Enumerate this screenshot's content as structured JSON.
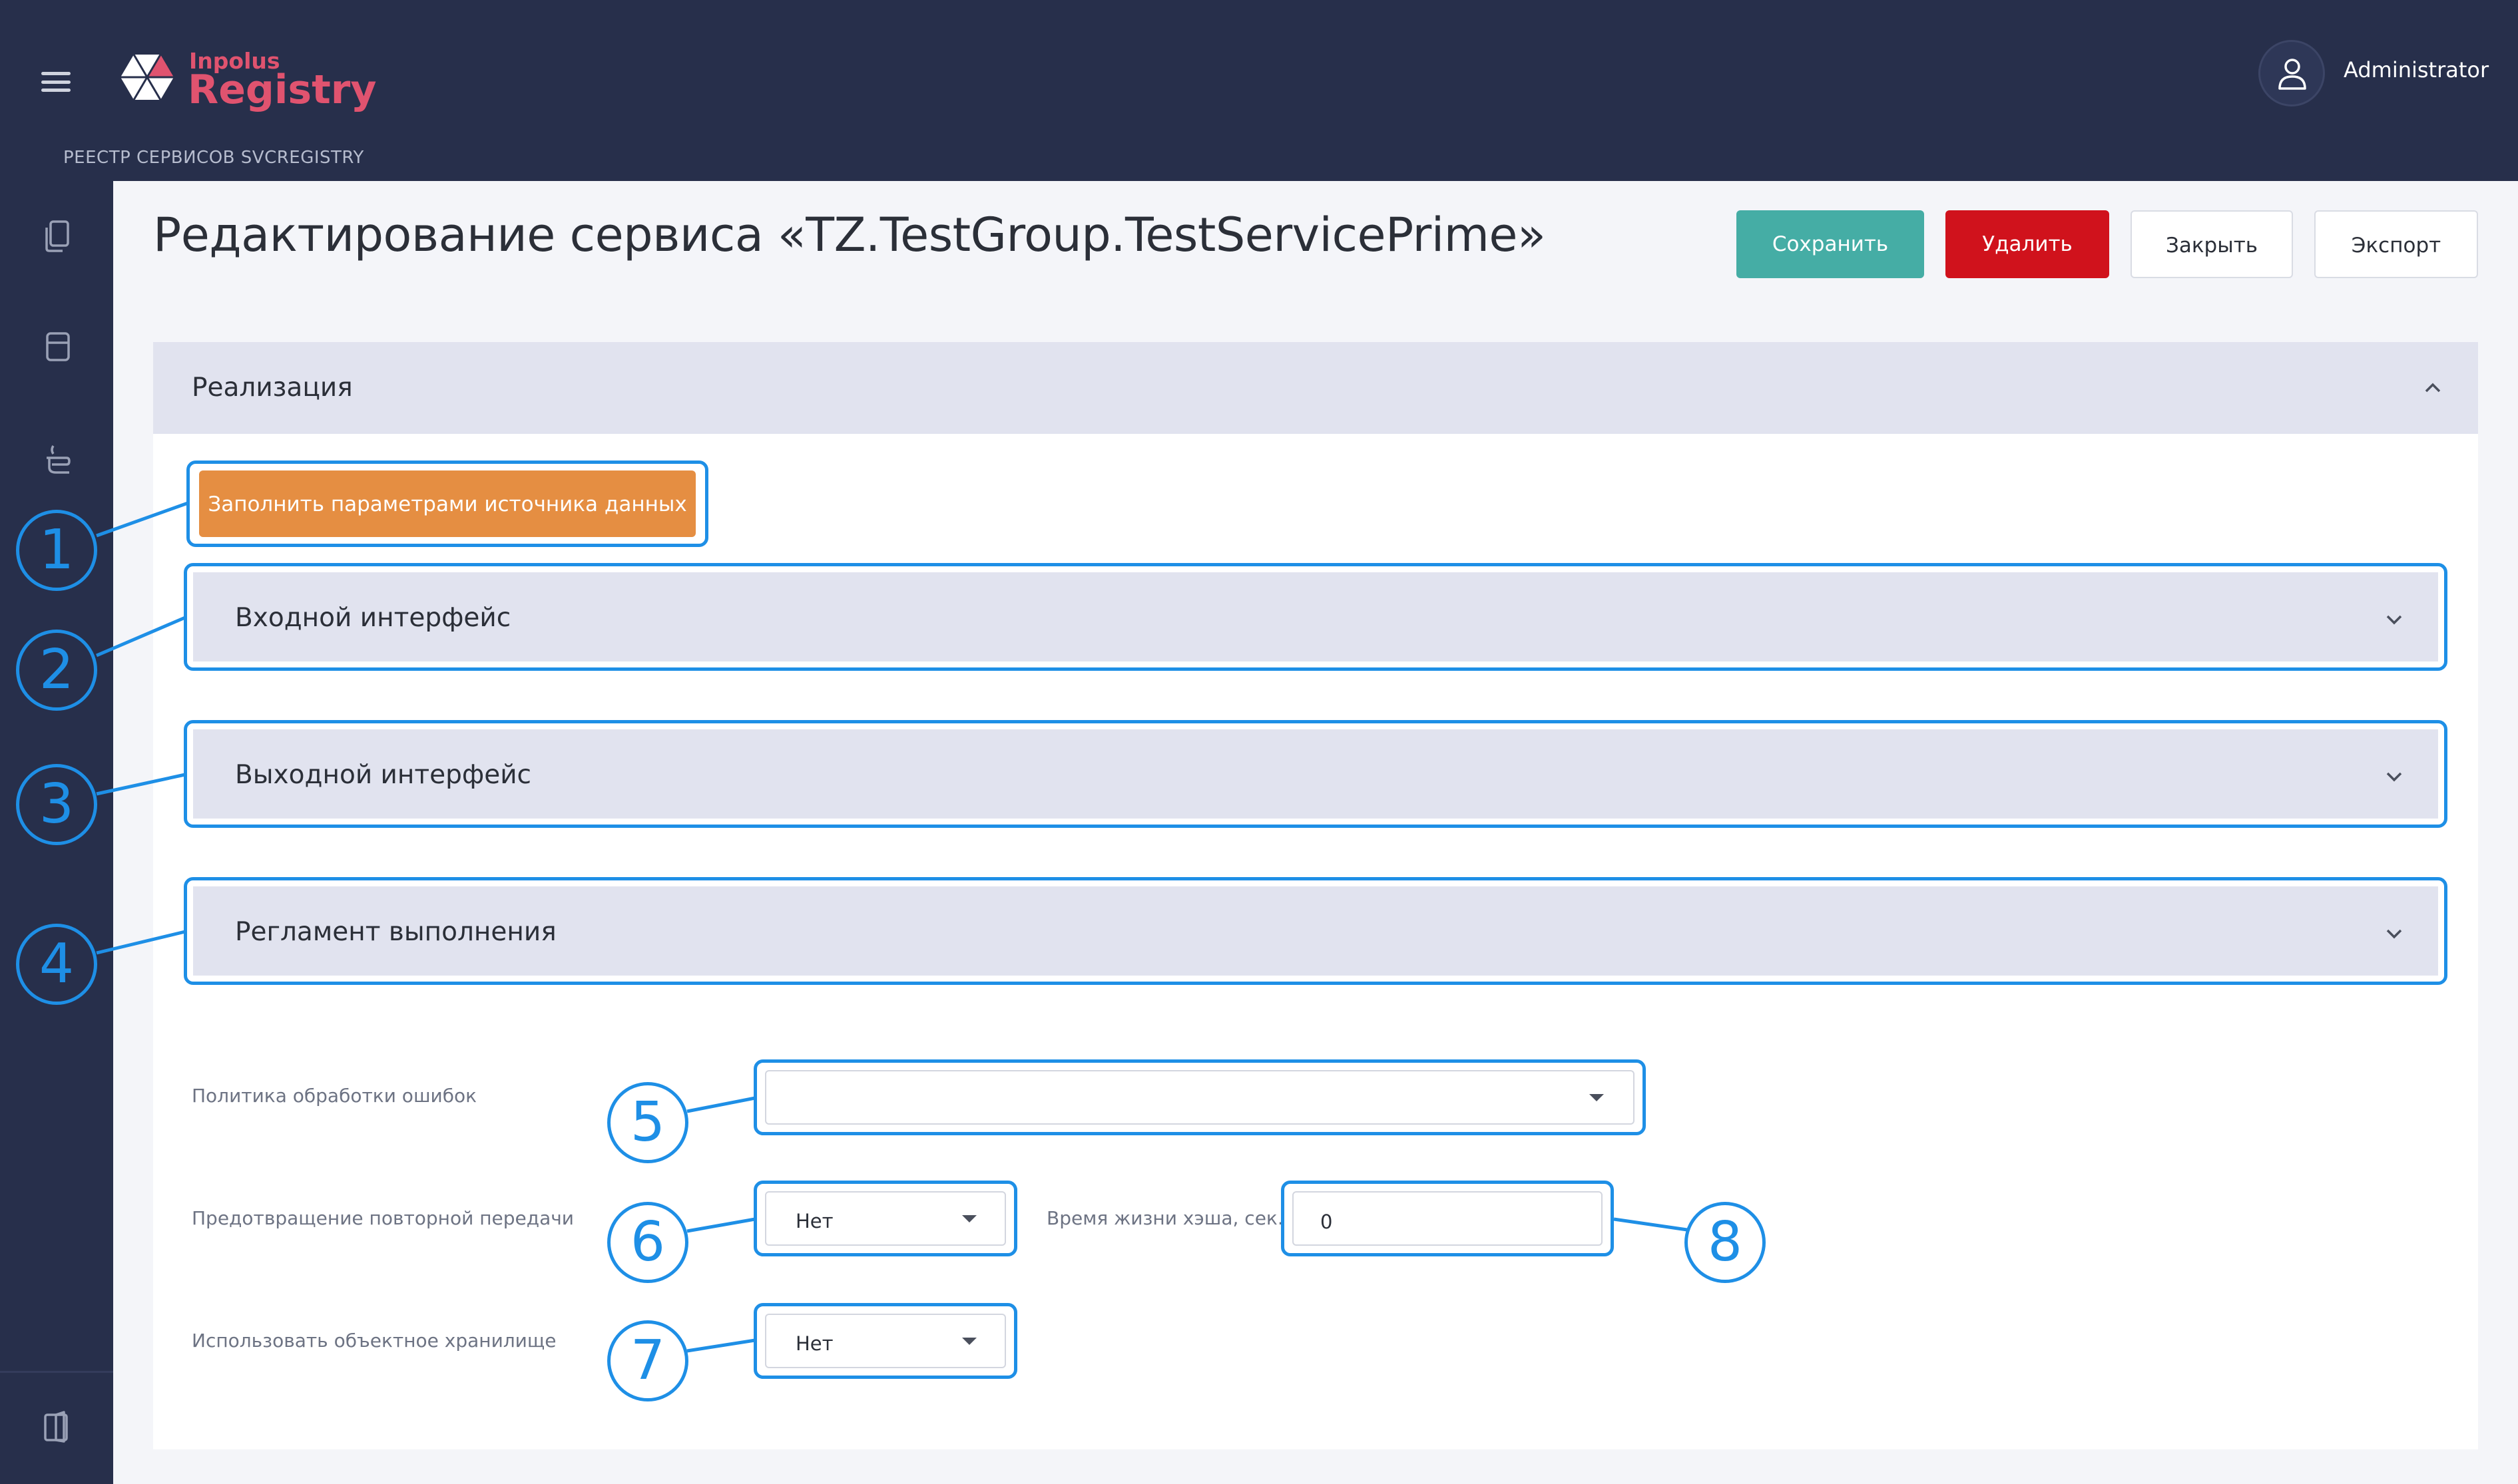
{
  "header": {
    "brand_small": "Inpolus",
    "brand_big": "Registry",
    "subtitle": "РЕЕСТР СЕРВИСОВ SVCREGISTRY",
    "username": "Administrator"
  },
  "page": {
    "title": "Редактирование сервиса «TZ.TestGroup.TestServicePrime»"
  },
  "toolbar": {
    "save_label": "Сохранить",
    "delete_label": "Удалить",
    "close_label": "Закрыть",
    "export_label": "Экспорт"
  },
  "section": {
    "title": "Реализация",
    "fill_button": "Заполнить параметрами источника данных",
    "accordions": [
      {
        "label": "Входной интерфейс"
      },
      {
        "label": "Выходной интерфейс"
      },
      {
        "label": "Регламент выполнения"
      }
    ]
  },
  "form": {
    "error_policy": {
      "label": "Политика обработки ошибок",
      "value": ""
    },
    "dedup": {
      "label": "Предотвращение повторной передачи",
      "value": "Нет"
    },
    "cache_ttl": {
      "label": "Время жизни хэша, сек.",
      "value": "0"
    },
    "object_storage": {
      "label": "Использовать объектное хранилище",
      "value": "Нет"
    }
  },
  "callouts": [
    "1",
    "2",
    "3",
    "4",
    "5",
    "6",
    "7",
    "8"
  ],
  "colors": {
    "header_bg": "#272f4b",
    "brand": "#e0536f",
    "save": "#45ada5",
    "delete": "#d0121c",
    "fill_button": "#e58e42",
    "callout": "#1e8fe6"
  },
  "icons": [
    "menu-icon",
    "logo-icon",
    "user-icon",
    "documents-icon",
    "database-icon",
    "service-icon",
    "exit-icon",
    "chevron-up-icon",
    "chevron-down-icon",
    "dropdown-caret-icon"
  ]
}
